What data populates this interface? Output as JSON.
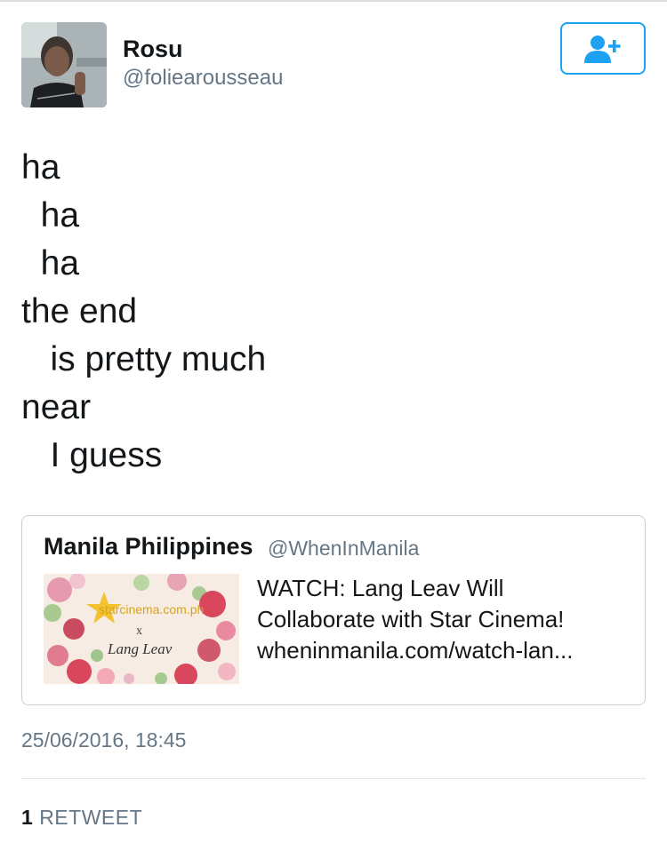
{
  "tweet": {
    "author": {
      "display_name": "Rosu",
      "handle": "@foliearousseau"
    },
    "follow_icon": "add-user-icon",
    "poem_lines": [
      "ha",
      "  ha",
      "  ha",
      "the end",
      "   is pretty much",
      "near",
      "   I guess"
    ],
    "quoted": {
      "display_name": "Manila Philippines",
      "handle": "@WhenInManila",
      "thumbnail": {
        "site_text": "starcinema.com.ph",
        "x_text": "x",
        "name_text": "Lang Leav"
      },
      "text_lines": [
        "WATCH: Lang Leav Will",
        "Collaborate with Star Cinema!",
        "wheninmanila.com/watch-lan..."
      ]
    },
    "timestamp": "25/06/2016, 18:45",
    "retweet_count": "1",
    "retweet_label": "RETWEET"
  },
  "colors": {
    "accent": "#1da1f2",
    "secondary_text": "#657786",
    "primary_text": "#14171a"
  }
}
